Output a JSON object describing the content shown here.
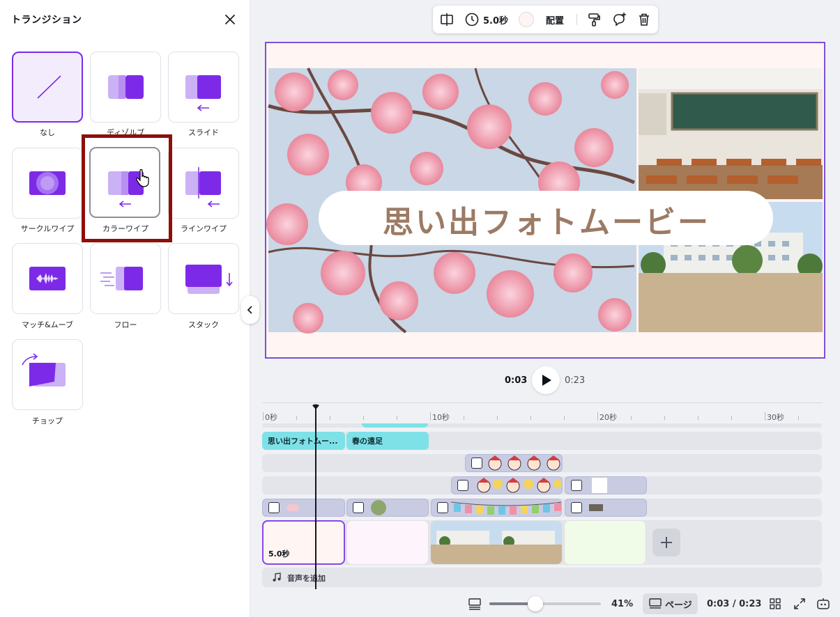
{
  "panel": {
    "title": "トランジション",
    "tiles": [
      {
        "label": "なし",
        "icon": "none-transition-icon",
        "selected": true
      },
      {
        "label": "ディゾルブ",
        "icon": "dissolve-icon"
      },
      {
        "label": "スライド",
        "icon": "slide-icon"
      },
      {
        "label": "サークルワイプ",
        "icon": "circle-wipe-icon"
      },
      {
        "label": "カラーワイプ",
        "icon": "color-wipe-icon",
        "hovered": true
      },
      {
        "label": "ラインワイプ",
        "icon": "line-wipe-icon"
      },
      {
        "label": "マッチ&ムーブ",
        "icon": "match-move-icon"
      },
      {
        "label": "フロー",
        "icon": "flow-icon"
      },
      {
        "label": "スタック",
        "icon": "stack-icon"
      },
      {
        "label": "チョップ",
        "icon": "chop-icon"
      }
    ]
  },
  "toolbar": {
    "duration": "5.0秒",
    "arrange": "配置"
  },
  "canvas": {
    "title": "思い出フォトムービー"
  },
  "playback": {
    "current": "0:03",
    "total": "0:23"
  },
  "timeline": {
    "ruler": [
      "0秒",
      "10秒",
      "20秒",
      "30秒"
    ],
    "text_clips": [
      "思い出フォトムー...",
      "春の遠足"
    ],
    "page1_duration": "5.0秒",
    "audio_label": "音声を追加"
  },
  "status": {
    "zoom_percent": 41,
    "zoom": "41%",
    "pages": "ページ",
    "time": "0:03 / 0:23"
  },
  "colors": {
    "accent": "#7d2ae8",
    "highlight": "#8c0f0b",
    "text_clip": "#7ee1e8",
    "title_text": "#9c7a64"
  }
}
